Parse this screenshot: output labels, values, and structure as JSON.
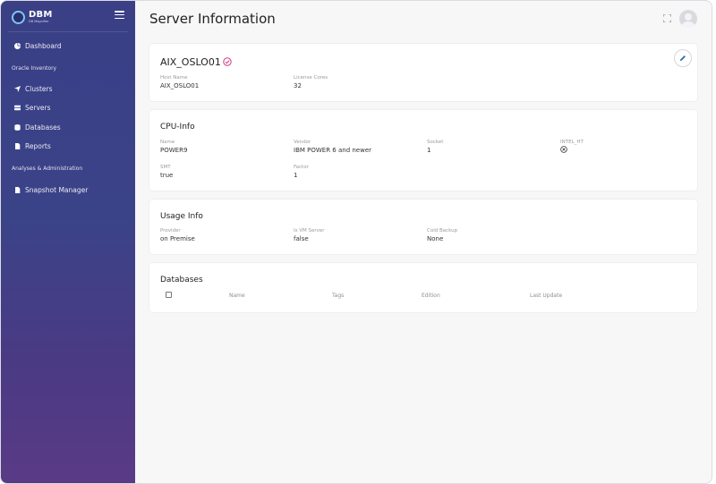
{
  "brand": {
    "title": "DBM",
    "subtitle": "DB Magnifier"
  },
  "sidebar": {
    "items": [
      {
        "label": "Dashboard",
        "icon": "dashboard-icon"
      },
      {
        "label": "Clusters",
        "icon": "send-icon"
      },
      {
        "label": "Servers",
        "icon": "server-icon"
      },
      {
        "label": "Databases",
        "icon": "database-icon"
      },
      {
        "label": "Reports",
        "icon": "file-icon"
      },
      {
        "label": "Snapshot Manager",
        "icon": "file-icon"
      }
    ],
    "sections": [
      "Oracle Inventory",
      "Analyses & Administration"
    ]
  },
  "page": {
    "title": "Server Information"
  },
  "server": {
    "name": "AIX_OSLO01",
    "host_name_label": "Host Name",
    "host_name": "AIX_OSLO01",
    "license_cores_label": "License Cores",
    "license_cores": "32"
  },
  "cpu": {
    "title": "CPU-Info",
    "name_label": "Name",
    "name": "POWER9",
    "vendor_label": "Vendor",
    "vendor": "IBM POWER 6 and newer",
    "socket_label": "Socket",
    "socket": "1",
    "intel_ht_label": "INTEL_HT",
    "smt_label": "SMT",
    "smt": "true",
    "factor_label": "Factor",
    "factor": "1"
  },
  "usage": {
    "title": "Usage Info",
    "provider_label": "Provider",
    "provider": "on Premise",
    "vm_label": "Is VM Server",
    "vm": "false",
    "cold_backup_label": "Cold Backup",
    "cold_backup": "None"
  },
  "databases": {
    "title": "Databases",
    "columns": [
      "Name",
      "Tags",
      "Edition",
      "Last Update"
    ]
  },
  "colors": {
    "accent_check": "#d63384",
    "sidebar_top": "#3a3f86",
    "sidebar_bottom": "#5a3a86"
  }
}
